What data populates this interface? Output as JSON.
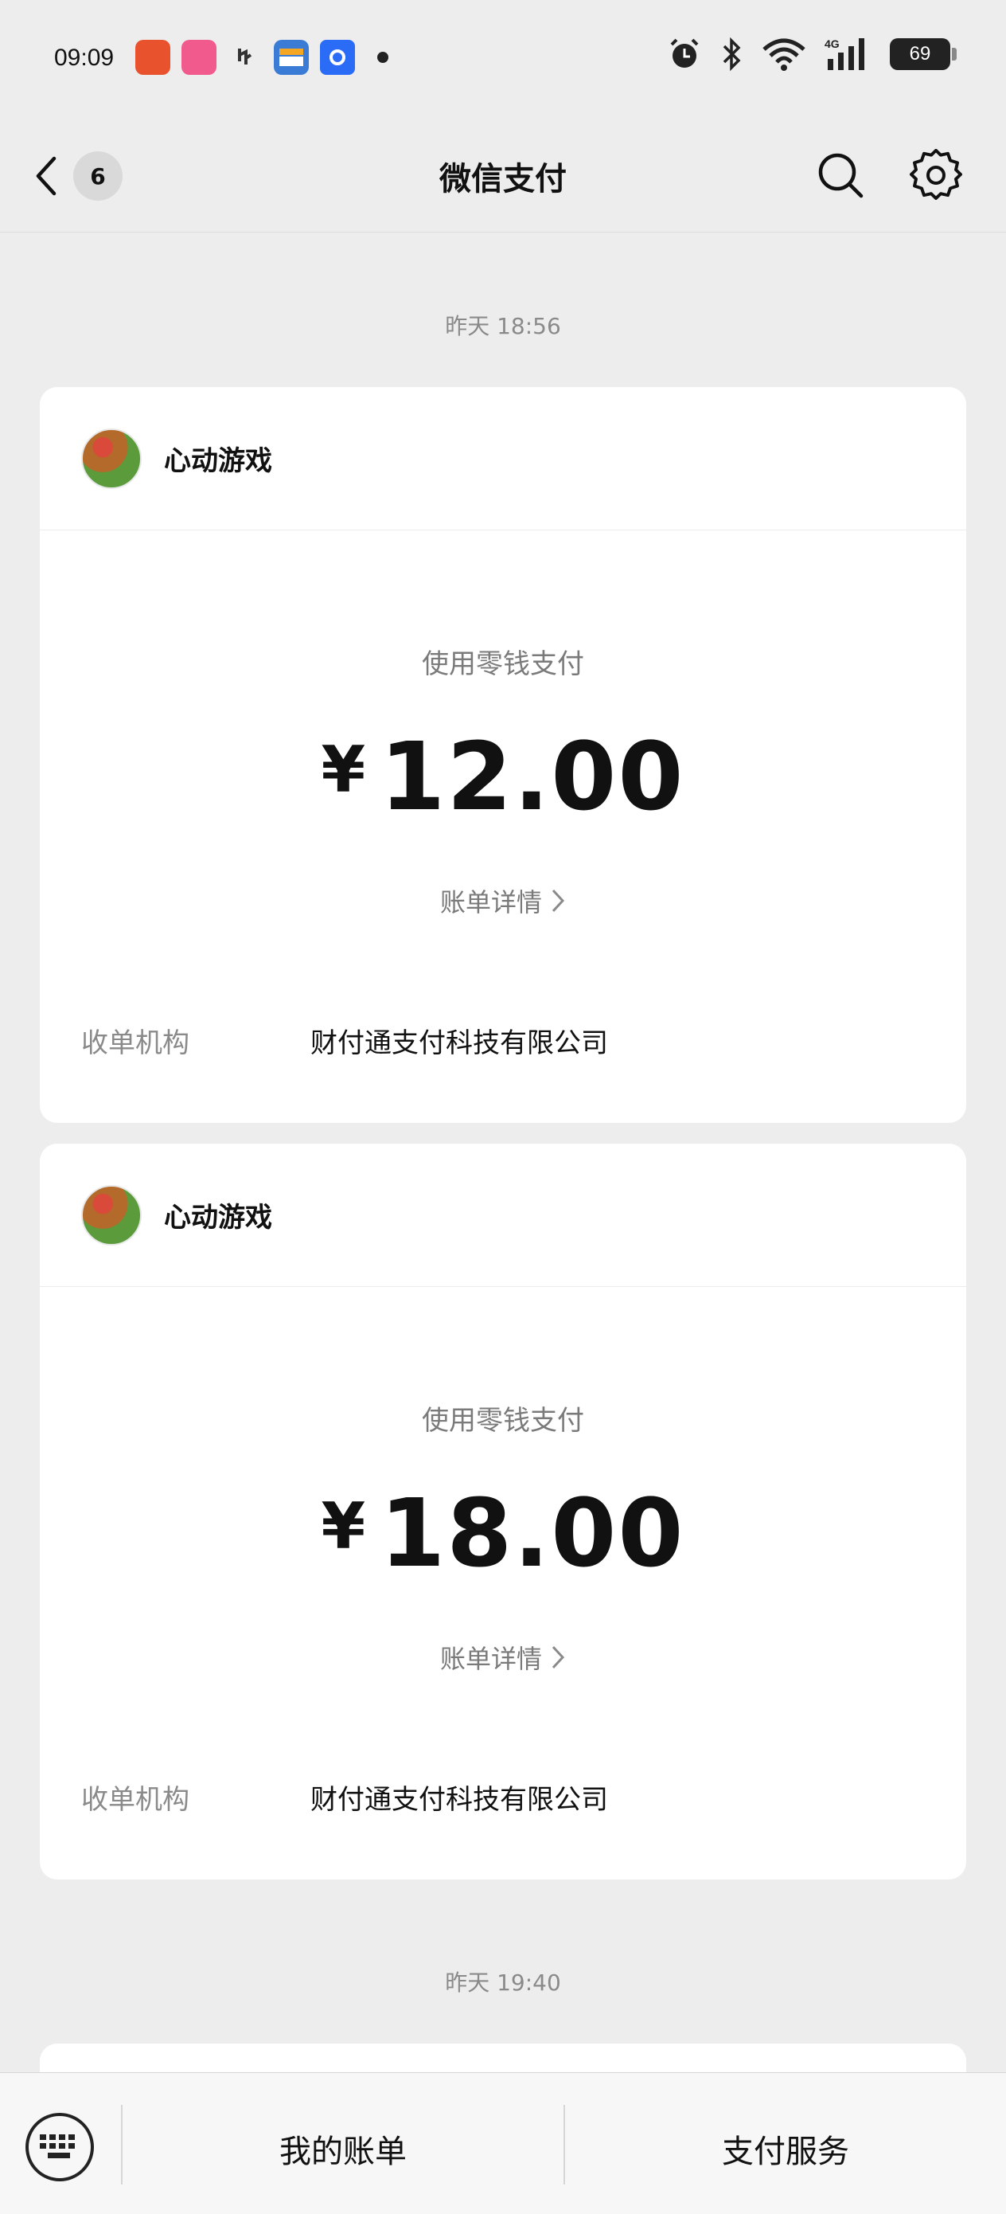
{
  "status_bar": {
    "time": "09:09",
    "battery": "69",
    "network": "4G"
  },
  "nav": {
    "back_badge": "6",
    "title": "微信支付"
  },
  "messages": [
    {
      "timestamp": "昨天  18:56",
      "merchant": "心动游戏",
      "pay_method": "使用零钱支付",
      "currency": "¥",
      "amount": "12.00",
      "detail_link": "账单详情",
      "acquirer_label": "收单机构",
      "acquirer_value": "财付通支付科技有限公司"
    },
    {
      "merchant": "心动游戏",
      "pay_method": "使用零钱支付",
      "currency": "¥",
      "amount": "18.00",
      "detail_link": "账单详情",
      "acquirer_label": "收单机构",
      "acquirer_value": "财付通支付科技有限公司"
    },
    {
      "timestamp": "昨天  19:40"
    }
  ],
  "bottom": {
    "tab1": "我的账单",
    "tab2": "支付服务"
  }
}
